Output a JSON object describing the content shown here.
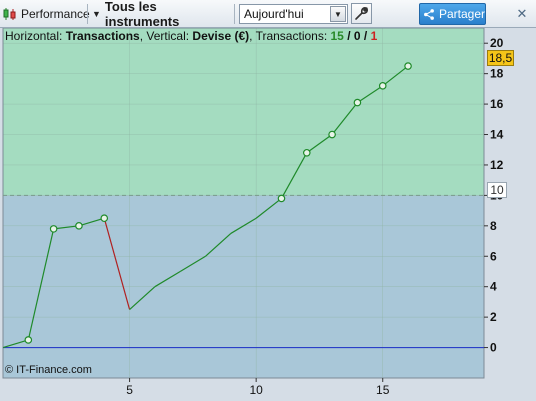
{
  "toolbar": {
    "performance_label": "Performance",
    "instruments_label": "Tous les instruments",
    "period_value": "Aujourd'hui",
    "share_label": "Partager",
    "close_glyph": "✕"
  },
  "info": {
    "prefix": "Horizontal: ",
    "horizontal": "Transactions",
    "mid": ", Vertical: ",
    "vertical": "Devise (€)",
    "tx_label": ", Transactions: ",
    "tx_total": "15",
    "slash1": " / ",
    "tx_zero": "0",
    "slash2": " / ",
    "tx_loss": "1"
  },
  "copyright": "© IT-Finance.com",
  "tags": {
    "last_value": "18,5",
    "threshold": "10"
  },
  "colors": {
    "gain_zone": "#a4dcc0",
    "base_zone": "#a9c7d8",
    "line_up": "#1f8a2a",
    "line_down": "#b02020",
    "zero_line": "#1a2cc8"
  },
  "chart_data": {
    "type": "line",
    "x": [
      0,
      1,
      2,
      3,
      4,
      5,
      6,
      7,
      8,
      9,
      10,
      11,
      12,
      13,
      14,
      15,
      16
    ],
    "y": [
      0,
      0.5,
      7.8,
      8.0,
      8.5,
      2.5,
      4.0,
      5.0,
      6.0,
      7.5,
      8.5,
      9.8,
      12.8,
      14.0,
      16.1,
      17.2,
      18.5
    ],
    "markers_at": [
      1,
      2,
      3,
      4,
      11,
      12,
      13,
      14,
      15,
      16
    ],
    "down_segment": [
      4,
      5
    ],
    "threshold": 10,
    "xlim": [
      0,
      19
    ],
    "ylim": [
      -2,
      21
    ],
    "x_ticks": [
      5,
      10,
      15
    ],
    "y_ticks": [
      0,
      2,
      4,
      6,
      8,
      10,
      12,
      14,
      16,
      18,
      20
    ],
    "grid": true
  }
}
